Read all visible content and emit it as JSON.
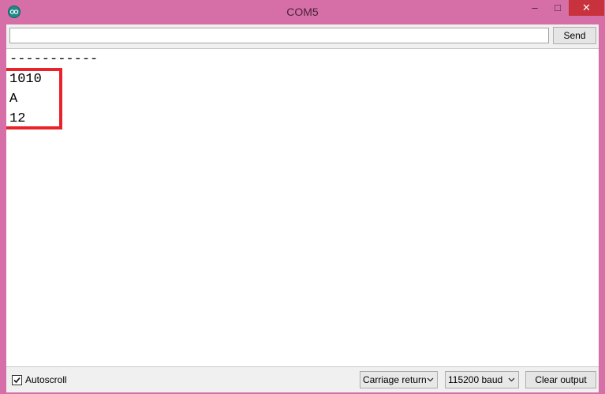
{
  "window": {
    "title": "COM5",
    "minimize_glyph": "–",
    "maximize_glyph": "□",
    "close_glyph": "✕",
    "icon": "arduino-logo-icon",
    "accent_color": "#d66fa7",
    "close_color": "#c7323c"
  },
  "input": {
    "value": "",
    "placeholder": "",
    "send_label": "Send"
  },
  "output": {
    "lines": [
      "-----------",
      "1010",
      "A",
      "12"
    ],
    "highlight_color": "#e8242a"
  },
  "footer": {
    "autoscroll_label": "Autoscroll",
    "autoscroll_checked": true,
    "line_ending": "Carriage return",
    "baud_rate": "115200 baud",
    "clear_label": "Clear output"
  }
}
